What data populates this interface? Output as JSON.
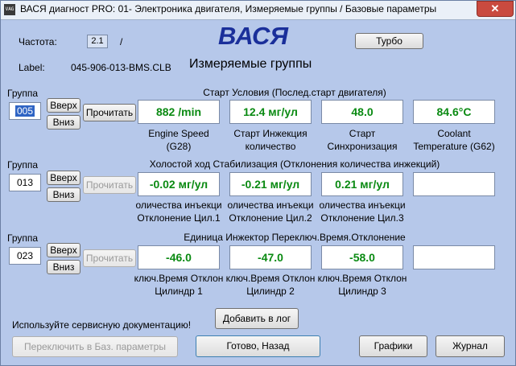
{
  "window": {
    "title": "ВАСЯ диагност PRO: 01- Электроника двигателя,  Измеряемые группы / Базовые параметры",
    "icon": "vag-app-icon",
    "close_symbol": "✕"
  },
  "header": {
    "frequency_label": "Частота:",
    "frequency_value": "2.1",
    "frequency_sep": "/",
    "logo": "ВАСЯ",
    "turbo_button": "Турбо",
    "label_caption": "Label:",
    "label_value": "045-906-013-BMS.CLB",
    "subtitle": "Измеряемые группы"
  },
  "groups": [
    {
      "group_label": "Группа",
      "id": "005",
      "up_label": "Вверх",
      "down_label": "Вниз",
      "read_label": "Прочитать",
      "read_enabled": true,
      "section_title": "Старт Условия (Послед.старт двигателя)",
      "fields": [
        {
          "value": "882 /min",
          "cap1": "Engine Speed",
          "cap2": "(G28)"
        },
        {
          "value": "12.4 мг/ул",
          "cap1": "Старт Инжекция",
          "cap2": "количество"
        },
        {
          "value": "48.0",
          "cap1": "Старт",
          "cap2": "Синхронизация"
        },
        {
          "value": "84.6°C",
          "cap1": "Coolant",
          "cap2": "Temperature (G62)"
        }
      ]
    },
    {
      "group_label": "Группа",
      "id": "013",
      "up_label": "Вверх",
      "down_label": "Вниз",
      "read_label": "Прочитать",
      "read_enabled": false,
      "section_title": "Холостой ход Стабилизация (Отклонения количества инжекций)",
      "fields": [
        {
          "value": "-0.02 мг/ул",
          "cap1": "оличества инъекци",
          "cap2": "Отклонение Цил.1"
        },
        {
          "value": "-0.21 мг/ул",
          "cap1": "оличества инъекци",
          "cap2": "Отклонение Цил.2"
        },
        {
          "value": "0.21 мг/ул",
          "cap1": "оличества инъекци",
          "cap2": "Отклонение Цил.3"
        },
        {
          "value": "",
          "cap1": "",
          "cap2": ""
        }
      ]
    },
    {
      "group_label": "Группа",
      "id": "023",
      "up_label": "Вверх",
      "down_label": "Вниз",
      "read_label": "Прочитать",
      "read_enabled": false,
      "section_title": "Единица Инжектор Переключ.Время.Отклонение",
      "fields": [
        {
          "value": "-46.0",
          "cap1": "ключ.Время Отклон",
          "cap2": "Цилиндр 1"
        },
        {
          "value": "-47.0",
          "cap1": "ключ.Время Отклон",
          "cap2": "Цилиндр 2"
        },
        {
          "value": "-58.0",
          "cap1": "ключ.Время Отклон",
          "cap2": "Цилиндр 3"
        },
        {
          "value": "",
          "cap1": "",
          "cap2": ""
        }
      ]
    }
  ],
  "footer": {
    "service_note": "Используйте сервисную документацию!",
    "add_log": "Добавить в лог",
    "switch_basic": "Переключить в Баз. параметры",
    "done_back": "Готово, Назад",
    "graphs": "Графики",
    "journal": "Журнал"
  },
  "colors": {
    "value_text": "#0a8a12",
    "background": "#b6c8ea",
    "logo": "#1a2f9a"
  }
}
